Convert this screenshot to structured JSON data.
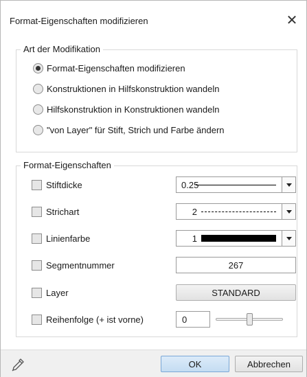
{
  "dialog": {
    "title": "Format-Eigenschaften modifizieren",
    "close_symbol": "✕"
  },
  "modification": {
    "legend": "Art der Modifikation",
    "options": [
      {
        "label": "Format-Eigenschaften modifizieren",
        "checked": true
      },
      {
        "label": "Konstruktionen in Hilfskonstruktion wandeln",
        "checked": false
      },
      {
        "label": "Hilfskonstruktion in Konstruktionen wandeln",
        "checked": false
      },
      {
        "label": "\"von Layer\" für Stift, Strich und Farbe ändern",
        "checked": false
      }
    ]
  },
  "format": {
    "legend": "Format-Eigenschaften",
    "pen": {
      "label": "Stiftdicke",
      "checked": false,
      "value": "0.25",
      "line_style": "solid"
    },
    "line_type": {
      "label": "Strichart",
      "checked": false,
      "value": "2",
      "line_style": "dashed"
    },
    "line_color": {
      "label": "Linienfarbe",
      "checked": false,
      "value": "1",
      "swatch_color": "#000000"
    },
    "segment": {
      "label": "Segmentnummer",
      "checked": false,
      "value": "267"
    },
    "layer": {
      "label": "Layer",
      "checked": false,
      "value": "STANDARD"
    },
    "order": {
      "label": "Reihenfolge (+ ist vorne)",
      "checked": false,
      "value": "0",
      "slider_fraction": 0.5
    }
  },
  "footer": {
    "ok_label": "OK",
    "cancel_label": "Abbrechen",
    "eyedropper_icon": "eyedropper-icon"
  },
  "colors": {
    "accent_button": "#c9dff4",
    "background": "#ffffff",
    "footer": "#f0f0f0"
  }
}
